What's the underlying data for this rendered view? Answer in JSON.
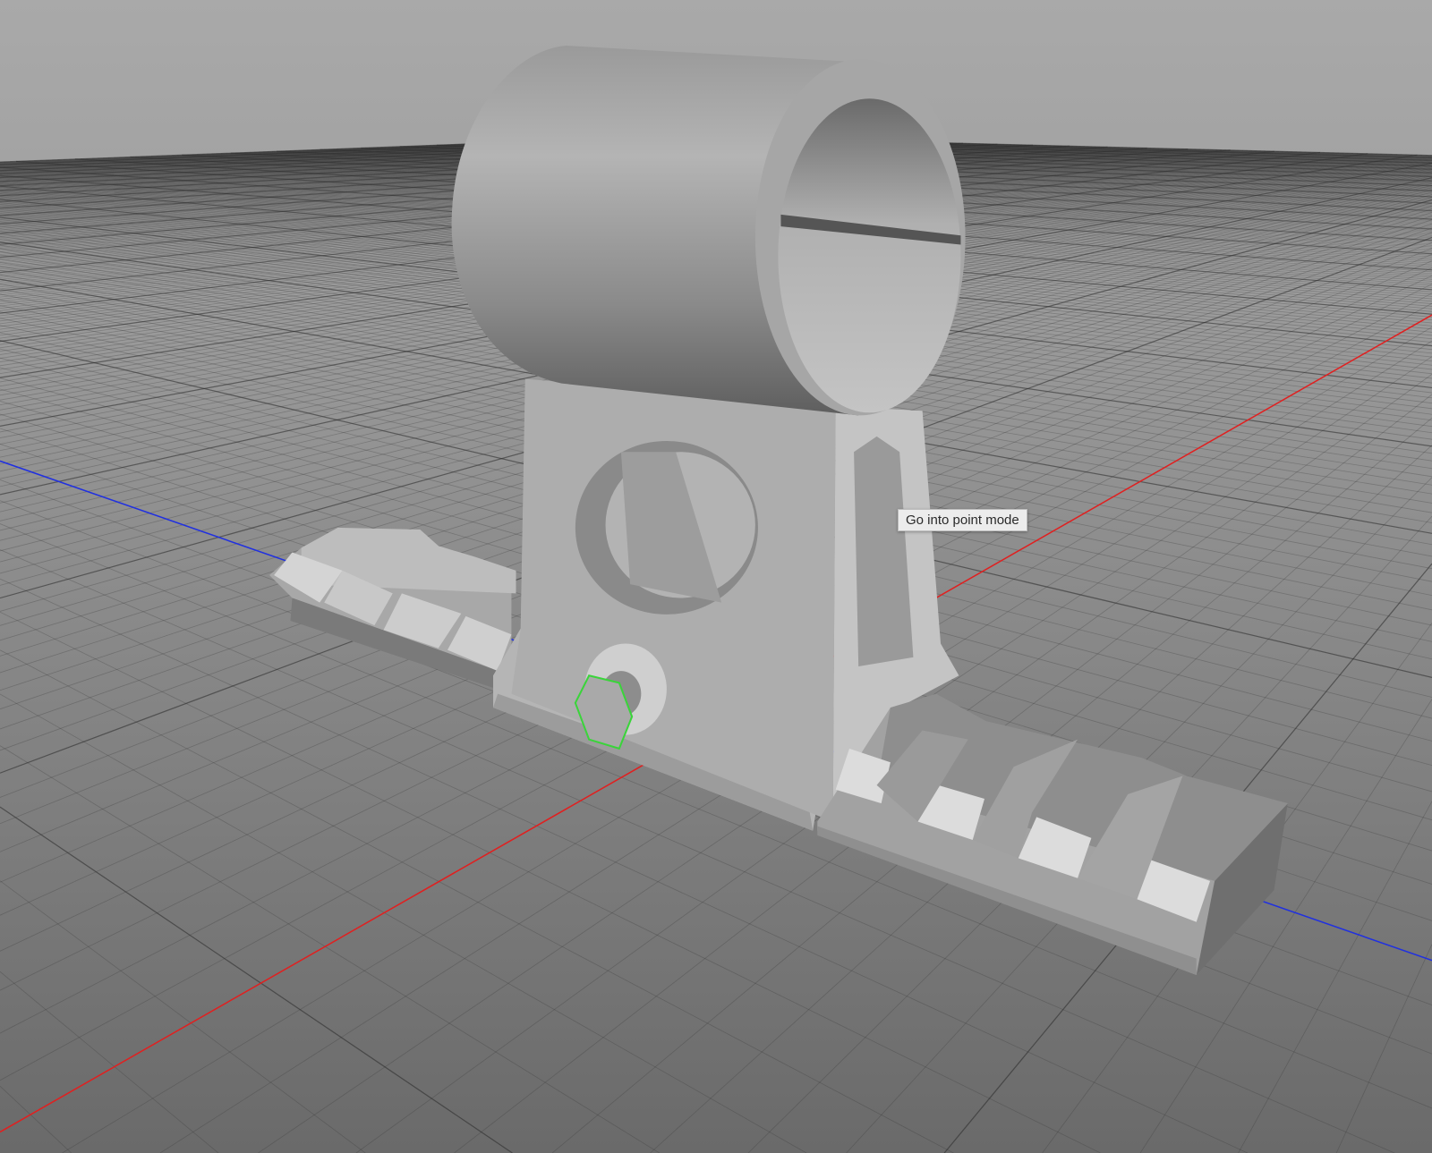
{
  "viewport": {
    "tooltip": "Go into point mode",
    "axis_colors": {
      "x": "#e02020",
      "z": "#2030e0"
    },
    "selection_color": "#3ad43a"
  }
}
